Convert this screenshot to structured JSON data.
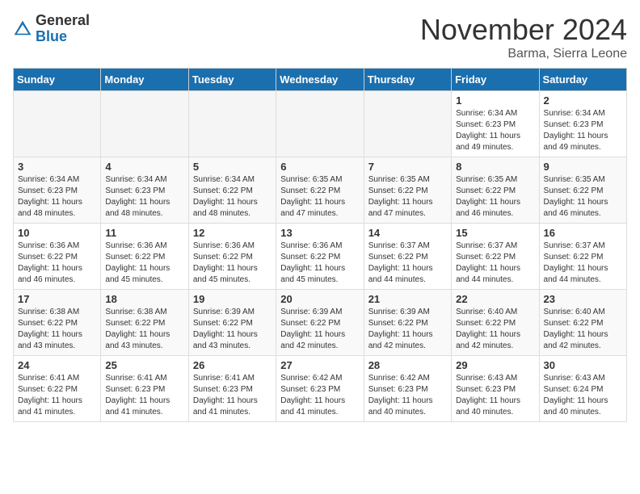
{
  "header": {
    "logo_general": "General",
    "logo_blue": "Blue",
    "month_title": "November 2024",
    "location": "Barma, Sierra Leone"
  },
  "days_of_week": [
    "Sunday",
    "Monday",
    "Tuesday",
    "Wednesday",
    "Thursday",
    "Friday",
    "Saturday"
  ],
  "weeks": [
    [
      {
        "num": "",
        "info": ""
      },
      {
        "num": "",
        "info": ""
      },
      {
        "num": "",
        "info": ""
      },
      {
        "num": "",
        "info": ""
      },
      {
        "num": "",
        "info": ""
      },
      {
        "num": "1",
        "info": "Sunrise: 6:34 AM\nSunset: 6:23 PM\nDaylight: 11 hours and 49 minutes."
      },
      {
        "num": "2",
        "info": "Sunrise: 6:34 AM\nSunset: 6:23 PM\nDaylight: 11 hours and 49 minutes."
      }
    ],
    [
      {
        "num": "3",
        "info": "Sunrise: 6:34 AM\nSunset: 6:23 PM\nDaylight: 11 hours and 48 minutes."
      },
      {
        "num": "4",
        "info": "Sunrise: 6:34 AM\nSunset: 6:23 PM\nDaylight: 11 hours and 48 minutes."
      },
      {
        "num": "5",
        "info": "Sunrise: 6:34 AM\nSunset: 6:22 PM\nDaylight: 11 hours and 48 minutes."
      },
      {
        "num": "6",
        "info": "Sunrise: 6:35 AM\nSunset: 6:22 PM\nDaylight: 11 hours and 47 minutes."
      },
      {
        "num": "7",
        "info": "Sunrise: 6:35 AM\nSunset: 6:22 PM\nDaylight: 11 hours and 47 minutes."
      },
      {
        "num": "8",
        "info": "Sunrise: 6:35 AM\nSunset: 6:22 PM\nDaylight: 11 hours and 46 minutes."
      },
      {
        "num": "9",
        "info": "Sunrise: 6:35 AM\nSunset: 6:22 PM\nDaylight: 11 hours and 46 minutes."
      }
    ],
    [
      {
        "num": "10",
        "info": "Sunrise: 6:36 AM\nSunset: 6:22 PM\nDaylight: 11 hours and 46 minutes."
      },
      {
        "num": "11",
        "info": "Sunrise: 6:36 AM\nSunset: 6:22 PM\nDaylight: 11 hours and 45 minutes."
      },
      {
        "num": "12",
        "info": "Sunrise: 6:36 AM\nSunset: 6:22 PM\nDaylight: 11 hours and 45 minutes."
      },
      {
        "num": "13",
        "info": "Sunrise: 6:36 AM\nSunset: 6:22 PM\nDaylight: 11 hours and 45 minutes."
      },
      {
        "num": "14",
        "info": "Sunrise: 6:37 AM\nSunset: 6:22 PM\nDaylight: 11 hours and 44 minutes."
      },
      {
        "num": "15",
        "info": "Sunrise: 6:37 AM\nSunset: 6:22 PM\nDaylight: 11 hours and 44 minutes."
      },
      {
        "num": "16",
        "info": "Sunrise: 6:37 AM\nSunset: 6:22 PM\nDaylight: 11 hours and 44 minutes."
      }
    ],
    [
      {
        "num": "17",
        "info": "Sunrise: 6:38 AM\nSunset: 6:22 PM\nDaylight: 11 hours and 43 minutes."
      },
      {
        "num": "18",
        "info": "Sunrise: 6:38 AM\nSunset: 6:22 PM\nDaylight: 11 hours and 43 minutes."
      },
      {
        "num": "19",
        "info": "Sunrise: 6:39 AM\nSunset: 6:22 PM\nDaylight: 11 hours and 43 minutes."
      },
      {
        "num": "20",
        "info": "Sunrise: 6:39 AM\nSunset: 6:22 PM\nDaylight: 11 hours and 42 minutes."
      },
      {
        "num": "21",
        "info": "Sunrise: 6:39 AM\nSunset: 6:22 PM\nDaylight: 11 hours and 42 minutes."
      },
      {
        "num": "22",
        "info": "Sunrise: 6:40 AM\nSunset: 6:22 PM\nDaylight: 11 hours and 42 minutes."
      },
      {
        "num": "23",
        "info": "Sunrise: 6:40 AM\nSunset: 6:22 PM\nDaylight: 11 hours and 42 minutes."
      }
    ],
    [
      {
        "num": "24",
        "info": "Sunrise: 6:41 AM\nSunset: 6:22 PM\nDaylight: 11 hours and 41 minutes."
      },
      {
        "num": "25",
        "info": "Sunrise: 6:41 AM\nSunset: 6:23 PM\nDaylight: 11 hours and 41 minutes."
      },
      {
        "num": "26",
        "info": "Sunrise: 6:41 AM\nSunset: 6:23 PM\nDaylight: 11 hours and 41 minutes."
      },
      {
        "num": "27",
        "info": "Sunrise: 6:42 AM\nSunset: 6:23 PM\nDaylight: 11 hours and 41 minutes."
      },
      {
        "num": "28",
        "info": "Sunrise: 6:42 AM\nSunset: 6:23 PM\nDaylight: 11 hours and 40 minutes."
      },
      {
        "num": "29",
        "info": "Sunrise: 6:43 AM\nSunset: 6:23 PM\nDaylight: 11 hours and 40 minutes."
      },
      {
        "num": "30",
        "info": "Sunrise: 6:43 AM\nSunset: 6:24 PM\nDaylight: 11 hours and 40 minutes."
      }
    ]
  ]
}
